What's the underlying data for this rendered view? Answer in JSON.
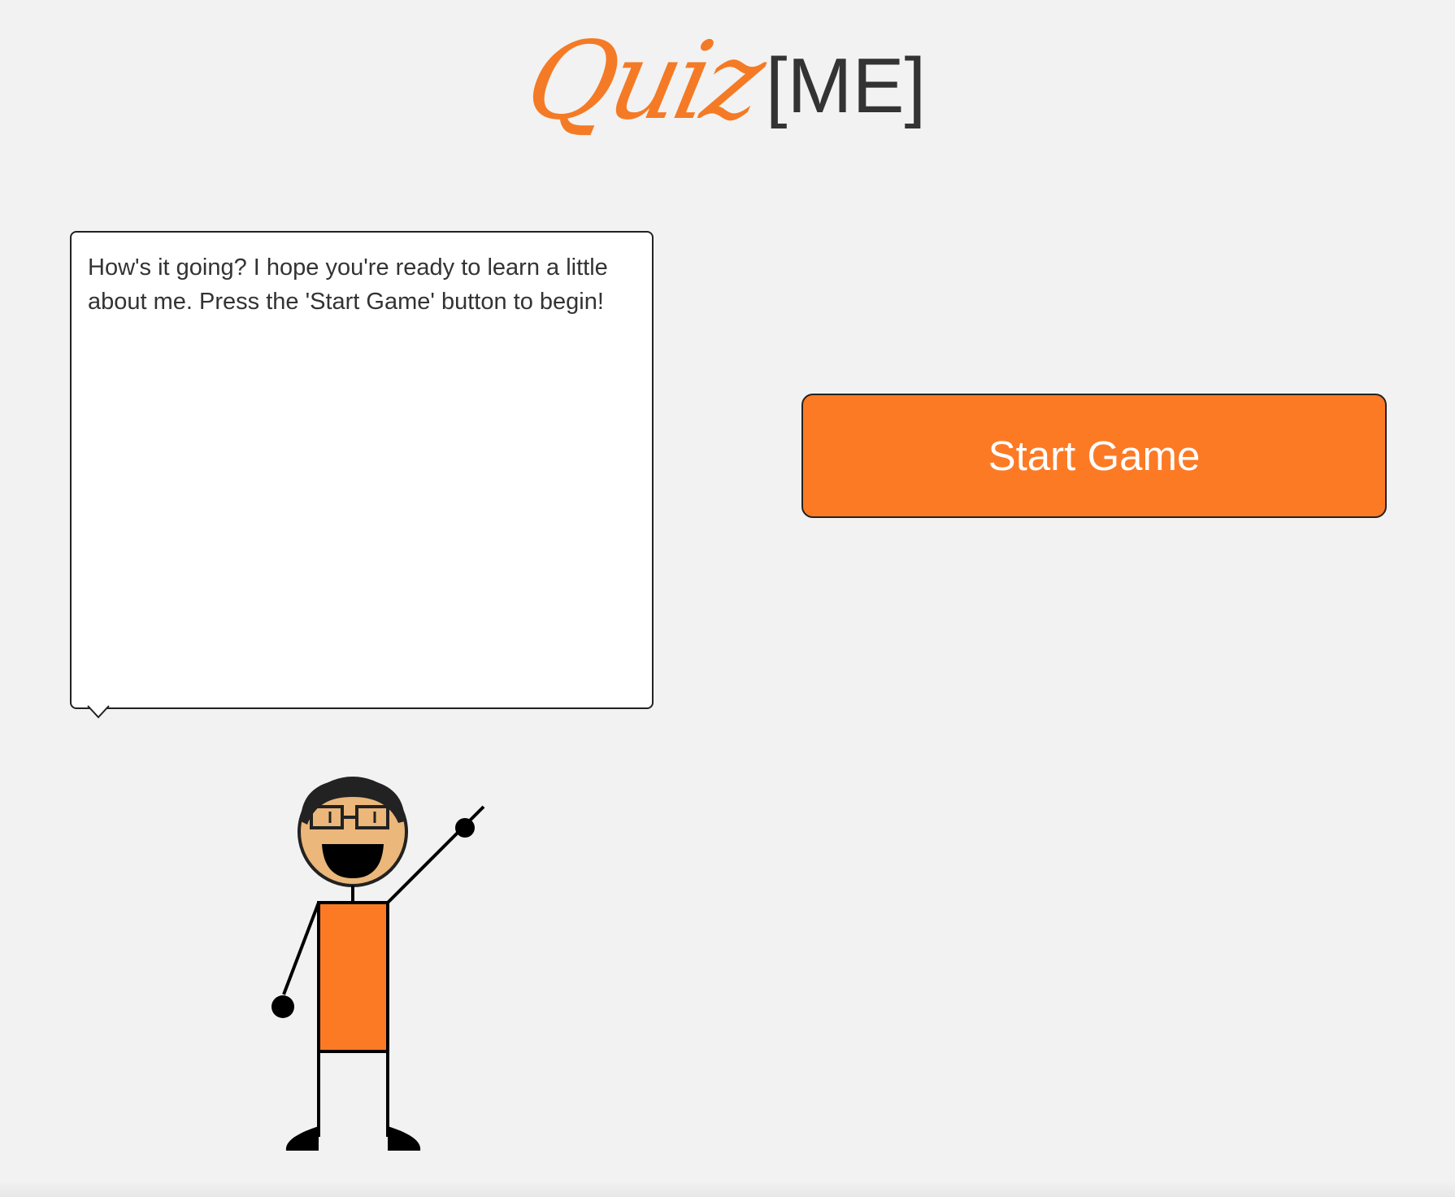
{
  "logo": {
    "script_text": "Quiz",
    "bracket_text": "[ME]"
  },
  "speech_bubble": {
    "text": "How's it going? I hope you're ready to learn a little about me. Press the 'Start Game' button to begin!"
  },
  "start_button": {
    "label": "Start Game"
  },
  "colors": {
    "accent": "#fd7a25",
    "background": "#f2f2f2",
    "text": "#333333",
    "skin": "#ebb77a"
  },
  "character": {
    "icon": "stick-figure-with-glasses-pointing-up"
  }
}
